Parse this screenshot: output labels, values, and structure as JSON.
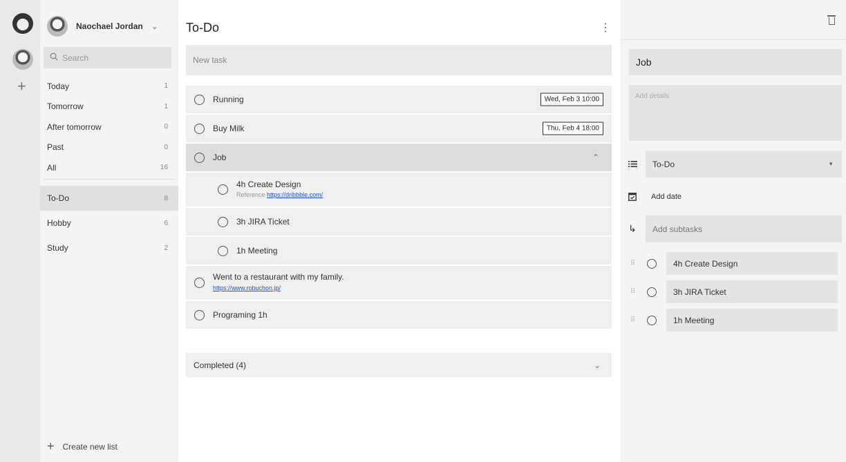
{
  "account": {
    "name": "Naochael Jordan"
  },
  "search": {
    "placeholder": "Search"
  },
  "filters": [
    {
      "label": "Today",
      "count": "1"
    },
    {
      "label": "Tomorrow",
      "count": "1"
    },
    {
      "label": "After tomorrow",
      "count": "0"
    },
    {
      "label": "Past",
      "count": "0"
    },
    {
      "label": "All",
      "count": "16"
    }
  ],
  "lists": [
    {
      "label": "To-Do",
      "count": "8",
      "active": true
    },
    {
      "label": "Hobby",
      "count": "6"
    },
    {
      "label": "Study",
      "count": "2"
    }
  ],
  "create_list_label": "Create new list",
  "main": {
    "title": "To-Do",
    "new_task_placeholder": "New task",
    "tasks": [
      {
        "title": "Running",
        "date": "Wed, Feb 3 10:00"
      },
      {
        "title": "Buy Milk",
        "date": "Thu, Feb 4 18:00"
      },
      {
        "title": "Job",
        "expanded": true
      },
      {
        "title": "4h Create Design",
        "note_prefix": "Reference",
        "note_link": "https://dribbble.com/",
        "sub": true
      },
      {
        "title": "3h JIRA Ticket",
        "sub": true
      },
      {
        "title": "1h Meeting",
        "sub": true
      },
      {
        "title": "Went to a restaurant with my family.",
        "link": "https://www.robuchon.jp/"
      },
      {
        "title": "Programing 1h"
      }
    ],
    "completed_label": "Completed (4)"
  },
  "detail": {
    "title": "Job",
    "details_placeholder": "Add details",
    "list": "To-Do",
    "add_date_label": "Add date",
    "add_subtasks_placeholder": "Add subtasks",
    "subtasks": [
      "4h Create Design",
      "3h JIRA Ticket",
      "1h Meeting"
    ]
  },
  "icons": {
    "list": "list-icon",
    "calendar": "calendar-icon",
    "subtask": "subtask-arrow-icon",
    "trash": "trash-icon"
  }
}
